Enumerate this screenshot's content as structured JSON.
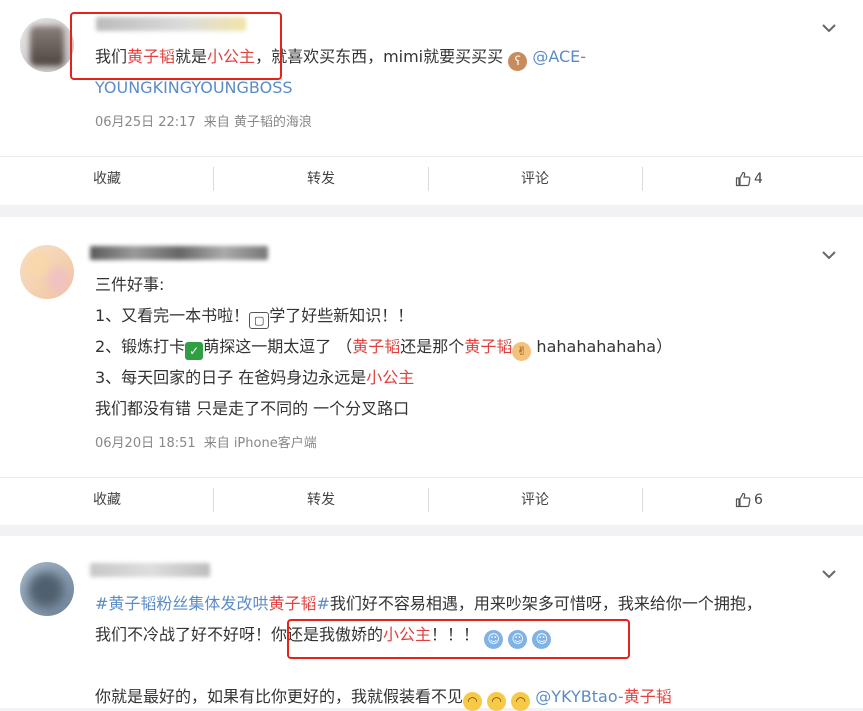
{
  "posts": [
    {
      "text_parts": [
        "我们",
        "黄子韬",
        "就是",
        "小公主",
        "，就喜欢买东西，mimi就要买买买"
      ],
      "mention_line1": "@ACE-",
      "mention_line2": "YOUNGKINGYOUNGBOSS",
      "date": "06月25日 22:17",
      "source": "来自 黄子韬的海浪",
      "actions": {
        "favorite": "收藏",
        "repost": "转发",
        "comment": "评论",
        "likes": "4"
      }
    },
    {
      "line1": "三件好事:",
      "line2_a": "1、又看完一本书啦！",
      "line2_b": "学了好些新知识！！",
      "line3_a": "2、锻炼打卡",
      "line3_b": "萌探这一期太逗了 （",
      "line3_c": "黄子韬",
      "line3_d": "还是那个",
      "line3_e": "黄子韬",
      "line3_f": "hahahahahaha）",
      "line4_a": "3、每天回家的日子 在爸妈身边永远是",
      "line4_b": "小公主",
      "line5": "我们都没有错 只是走了不同的 一个分叉路口",
      "date": "06月20日 18:51",
      "source": "来自 iPhone客户端",
      "actions": {
        "favorite": "收藏",
        "repost": "转发",
        "comment": "评论",
        "likes": "6"
      }
    },
    {
      "line1_a": "#黄子韬",
      "line1_b": "粉丝集体发",
      "line1_c": "改哄",
      "line1_d": "黄子韬",
      "line1_e": "#",
      "line1_f": "我们好不容易相遇，用来吵架多可惜呀，我来给你一个拥抱，",
      "line2_a": "我们不冷战了好不好呀！",
      "line2_b": "你还是我傲娇的",
      "line2_c": "小公主",
      "line2_d": "！！！",
      "line3_a": "你就是最好的，如果有比你更好的，我就假装看不见",
      "line3_mention": "@YKYBtao-",
      "line3_b": "黄子韬"
    }
  ],
  "colors": {
    "highlight": "#e0413f",
    "link": "#5b8cc7",
    "annotation_box": "#e3231c"
  },
  "icons": [
    "chevron-down-icon",
    "thumbs-up-icon"
  ]
}
